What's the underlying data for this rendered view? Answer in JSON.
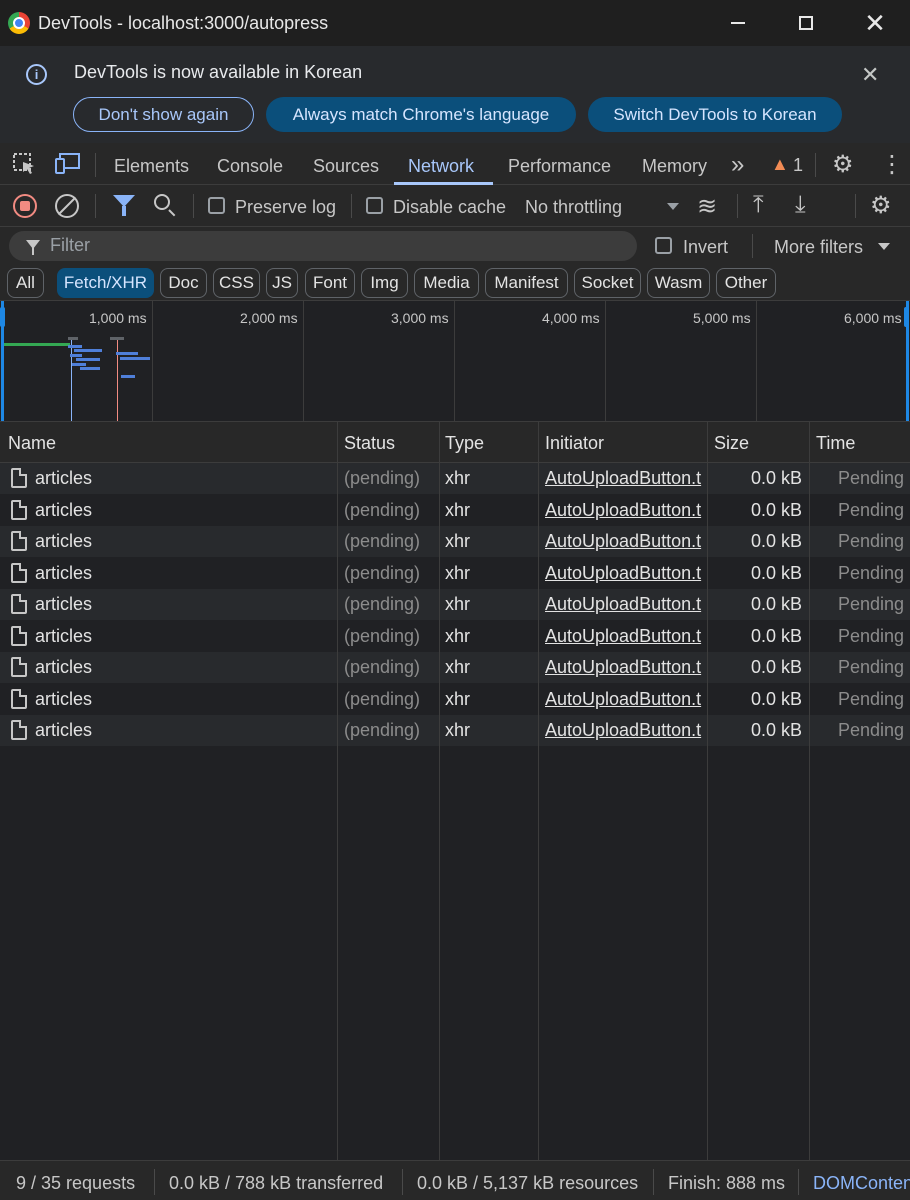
{
  "window": {
    "title": "DevTools - localhost:3000/autopress",
    "close_glyph": "✕"
  },
  "infobar": {
    "message": "DevTools is now available in Korean",
    "info_glyph": "i",
    "close_glyph": "✕",
    "buttons": {
      "dont_show": "Don't show again",
      "match_language": "Always match Chrome's language",
      "switch": "Switch DevTools to Korean"
    }
  },
  "tabs": {
    "items": [
      {
        "label": "Elements"
      },
      {
        "label": "Console"
      },
      {
        "label": "Sources"
      },
      {
        "label": "Network"
      },
      {
        "label": "Performance"
      },
      {
        "label": "Memory"
      }
    ],
    "more_glyph": "»",
    "warning_glyph": "▲",
    "warning_count": "1",
    "settings_glyph": "⚙",
    "kebab_glyph": "⋮"
  },
  "network_toolbar": {
    "preserve_log": "Preserve log",
    "disable_cache": "Disable cache",
    "throttling": "No throttling",
    "wifi_glyph": "≋",
    "upload_glyph": "⤒",
    "download_glyph": "⤓",
    "settings_glyph": "⚙"
  },
  "filter": {
    "placeholder": "Filter",
    "invert": "Invert",
    "more_filters": "More filters"
  },
  "type_filters": [
    {
      "label": "All",
      "active": false
    },
    {
      "label": "Fetch/XHR",
      "active": true
    },
    {
      "label": "Doc",
      "active": false
    },
    {
      "label": "CSS",
      "active": false
    },
    {
      "label": "JS",
      "active": false
    },
    {
      "label": "Font",
      "active": false
    },
    {
      "label": "Img",
      "active": false
    },
    {
      "label": "Media",
      "active": false
    },
    {
      "label": "Manifest",
      "active": false
    },
    {
      "label": "Socket",
      "active": false
    },
    {
      "label": "Wasm",
      "active": false
    },
    {
      "label": "Other",
      "active": false
    }
  ],
  "overview": {
    "ticks": [
      "1,000 ms",
      "2,000 ms",
      "3,000 ms",
      "4,000 ms",
      "5,000 ms",
      "6,000 ms"
    ]
  },
  "table": {
    "columns": {
      "name": "Name",
      "status": "Status",
      "type": "Type",
      "initiator": "Initiator",
      "size": "Size",
      "time": "Time"
    },
    "rows": [
      {
        "name": "articles",
        "status": "(pending)",
        "type": "xhr",
        "initiator": "AutoUploadButton.t",
        "size": "0.0 kB",
        "time": "Pending"
      },
      {
        "name": "articles",
        "status": "(pending)",
        "type": "xhr",
        "initiator": "AutoUploadButton.t",
        "size": "0.0 kB",
        "time": "Pending"
      },
      {
        "name": "articles",
        "status": "(pending)",
        "type": "xhr",
        "initiator": "AutoUploadButton.t",
        "size": "0.0 kB",
        "time": "Pending"
      },
      {
        "name": "articles",
        "status": "(pending)",
        "type": "xhr",
        "initiator": "AutoUploadButton.t",
        "size": "0.0 kB",
        "time": "Pending"
      },
      {
        "name": "articles",
        "status": "(pending)",
        "type": "xhr",
        "initiator": "AutoUploadButton.t",
        "size": "0.0 kB",
        "time": "Pending"
      },
      {
        "name": "articles",
        "status": "(pending)",
        "type": "xhr",
        "initiator": "AutoUploadButton.t",
        "size": "0.0 kB",
        "time": "Pending"
      },
      {
        "name": "articles",
        "status": "(pending)",
        "type": "xhr",
        "initiator": "AutoUploadButton.t",
        "size": "0.0 kB",
        "time": "Pending"
      },
      {
        "name": "articles",
        "status": "(pending)",
        "type": "xhr",
        "initiator": "AutoUploadButton.t",
        "size": "0.0 kB",
        "time": "Pending"
      },
      {
        "name": "articles",
        "status": "(pending)",
        "type": "xhr",
        "initiator": "AutoUploadButton.t",
        "size": "0.0 kB",
        "time": "Pending"
      }
    ]
  },
  "summary": {
    "requests": "9 / 35 requests",
    "transferred": "0.0 kB / 788 kB transferred",
    "resources": "0.0 kB / 5,137 kB resources",
    "finish": "Finish: 888 ms",
    "dom": "DOMContentLoaded"
  },
  "colors": {
    "accent": "#a8c7fa",
    "active_chip": "#0b4f7b",
    "record": "#f28b82",
    "warning": "#f28b54"
  }
}
